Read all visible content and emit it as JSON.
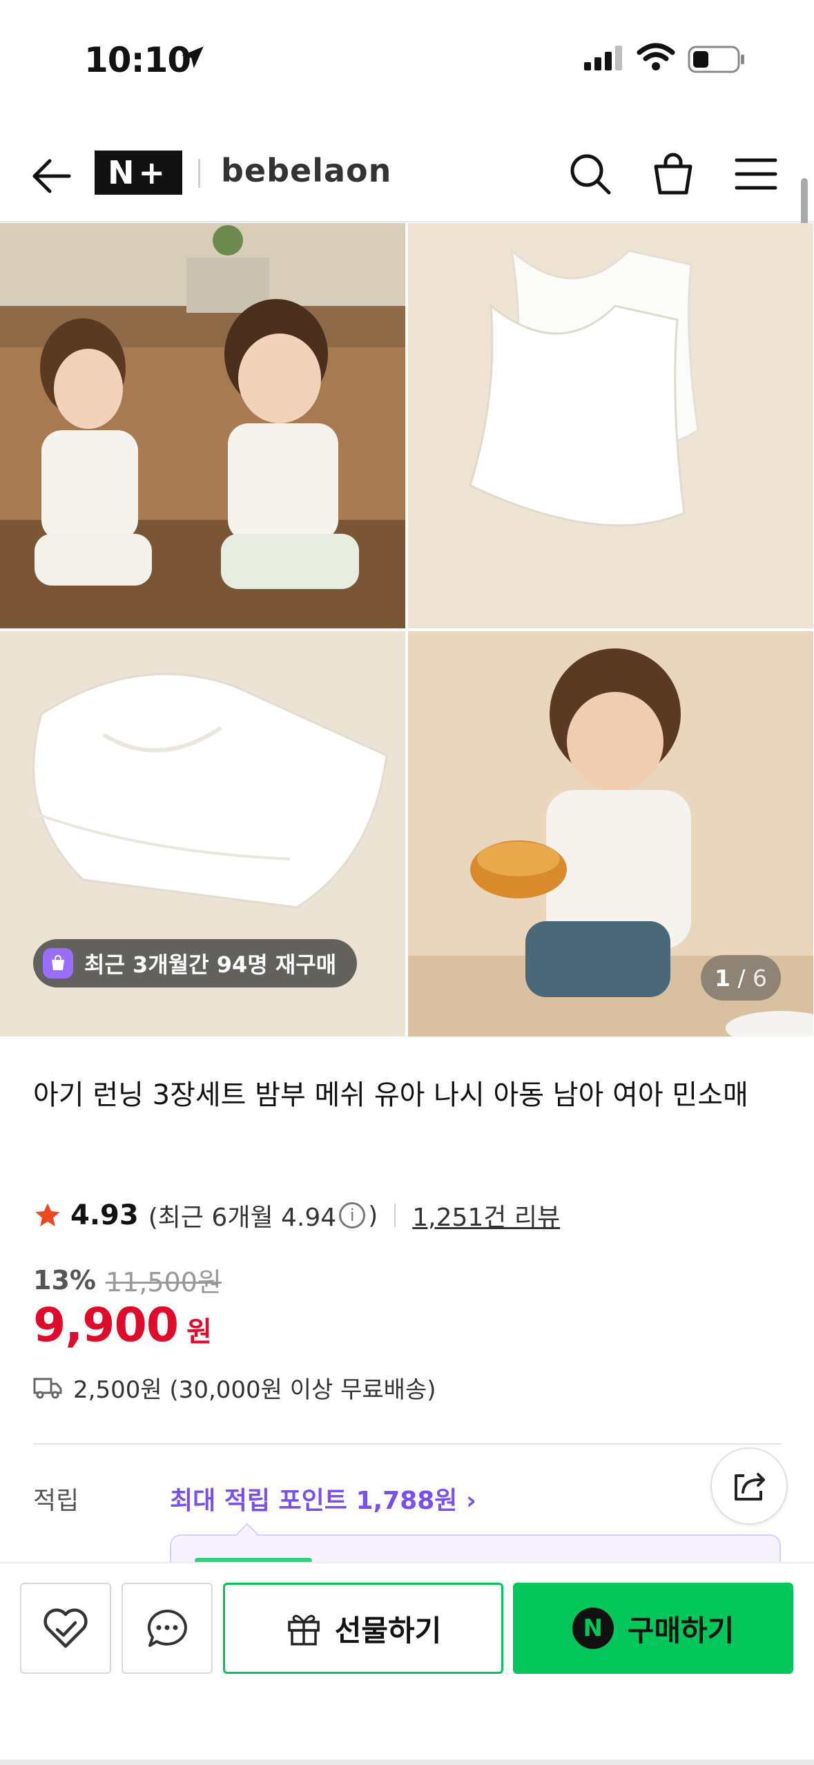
{
  "status_bar": {
    "time": "10:10"
  },
  "nav": {
    "logo_text": "N+",
    "brand": "bebelaon",
    "icons": [
      "back-arrow-icon",
      "search-icon",
      "shopping-bag-icon",
      "menu-icon"
    ]
  },
  "gallery": {
    "rebuy_badge": "최근 3개월간 94명 재구매",
    "page_current": "1",
    "page_separator": " / ",
    "page_total": "6"
  },
  "product": {
    "title": "아기 런닝 3장세트 밤부 메쉬 유아 나시 아동 남아 여아 민소매",
    "rating": "4.93",
    "rating_recent_prefix": "(최근 6개월 4.94",
    "rating_recent_suffix": ")",
    "review_link": "1,251건 리뷰",
    "discount": "13%",
    "original_price": "11,500원",
    "price": "9,900",
    "price_unit": "원",
    "shipping": "2,500원 (30,000원 이상 무료배송)"
  },
  "points": {
    "label": "적립",
    "link": "최대 적립 포인트 1,788원 ›"
  },
  "bottom_bar": {
    "gift_label": "선물하기",
    "buy_label": "구매하기",
    "npay_letter": "N"
  },
  "colors": {
    "accent_green": "#03c75a",
    "price_red": "#e00b2b",
    "points_purple": "#7b4ef0"
  }
}
